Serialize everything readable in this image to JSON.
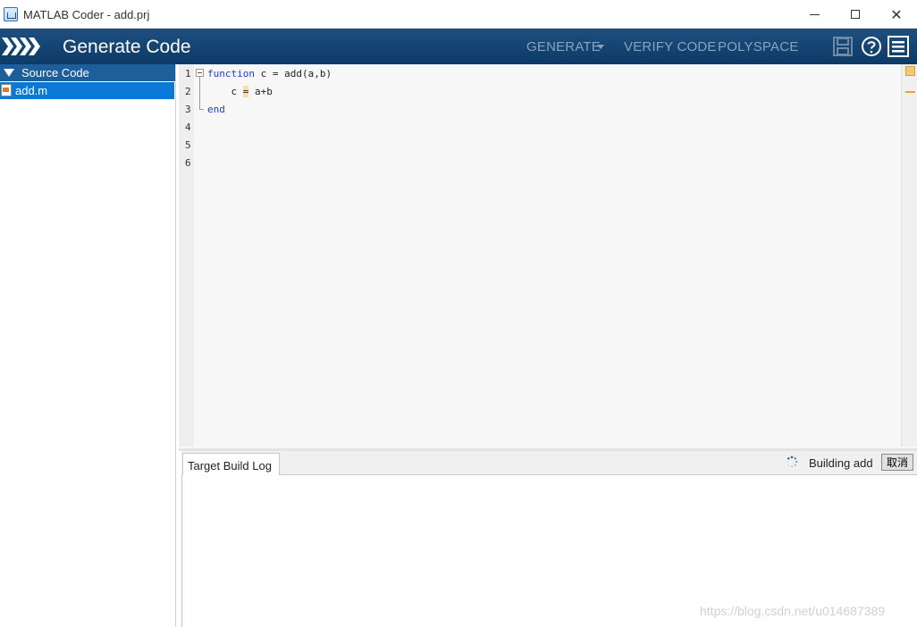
{
  "window": {
    "title": "MATLAB Coder - add.prj",
    "minimize_glyph": "",
    "maximize_glyph": "",
    "close_glyph": "✕"
  },
  "header": {
    "title": "Generate Code",
    "nav": {
      "generate": "GENERATE",
      "verify": "VERIFY CODE",
      "polyspace": "POLYSPACE"
    },
    "icons": [
      "save-icon",
      "help-icon",
      "menu-icon"
    ]
  },
  "sidebar": {
    "section_title": "Source Code",
    "files": [
      {
        "label": "add.m",
        "selected": true
      }
    ]
  },
  "editor": {
    "line_numbers": [
      "1",
      "2",
      "3",
      "4",
      "5",
      "6"
    ],
    "lines": [
      {
        "keyword": "function",
        "text": " c = add(a,b)"
      },
      {
        "prefix": "    c ",
        "highlight": "=",
        "suffix": " a+b"
      },
      {
        "keyword": "end",
        "text": ""
      }
    ]
  },
  "build_log": {
    "tab_label": "Target Build Log",
    "status_text": "Building add",
    "cancel_label": "取消"
  },
  "watermark": "https://blog.csdn.net/u014687389",
  "colors": {
    "header_bg": "#0d3a66",
    "selection": "#0a78d7",
    "section_header": "#1e5e9a",
    "keyword": "#1a3ddb"
  }
}
